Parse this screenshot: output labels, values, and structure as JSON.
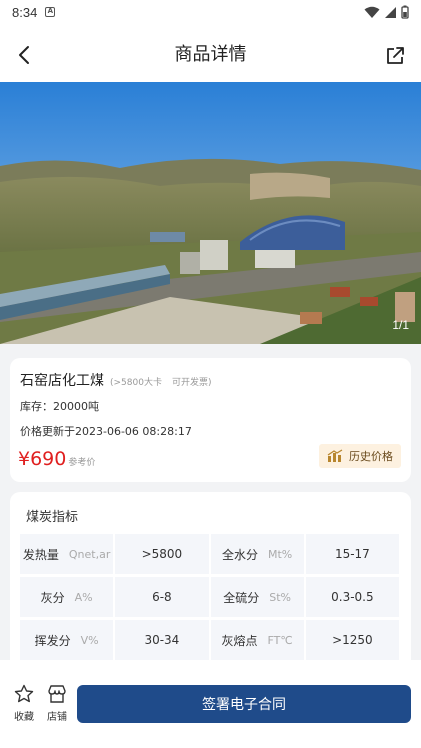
{
  "status_bar": {
    "time": "8:34",
    "notification_badge": "A"
  },
  "nav": {
    "title": "商品详情"
  },
  "hero": {
    "counter": "1/1"
  },
  "product": {
    "name": "石窑店化工煤",
    "tag_calorific": "(>5800大卡",
    "tag_invoice": "可开发票)",
    "stock": "库存：20000吨",
    "updated": "价格更新于2023-06-06 08:28:17",
    "price": "¥690",
    "price_note": "参考价",
    "history_button": "历史价格"
  },
  "coal_indicators": {
    "title": "煤炭指标",
    "rows": [
      {
        "k1": "发热量",
        "u1": "Qnet,ar",
        "v1": ">5800",
        "k2": "全水分",
        "u2": "Mt%",
        "v2": "15-17"
      },
      {
        "k1": "灰分",
        "u1": "A%",
        "v1": "6-8",
        "k2": "全硫分",
        "u2": "St%",
        "v2": "0.3-0.5"
      },
      {
        "k1": "挥发分",
        "u1": "V%",
        "v1": "30-34",
        "k2": "灰熔点",
        "u2": "FT℃",
        "v2": ">1250"
      }
    ]
  },
  "bottom_bar": {
    "favorite_label": "收藏",
    "store_label": "店铺",
    "sign_button": "签署电子合同"
  },
  "colors": {
    "primary": "#1f4b8a",
    "price": "#e02020",
    "history_bg": "#fdf1e0"
  }
}
